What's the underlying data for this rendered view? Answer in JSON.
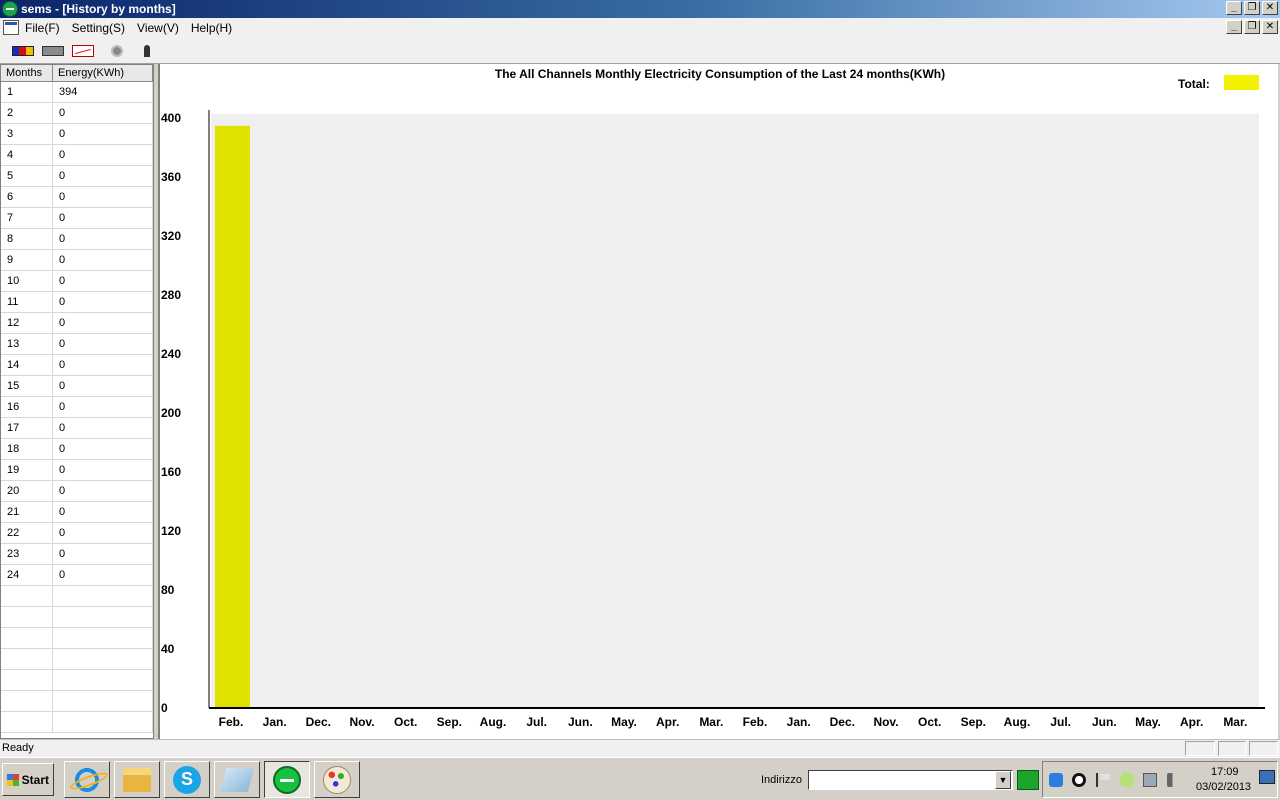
{
  "window": {
    "title": "sems - [History by months]"
  },
  "menu": {
    "items": [
      "File(F)",
      "Setting(S)",
      "View(V)",
      "Help(H)"
    ]
  },
  "table": {
    "headers": [
      "Months",
      "Energy(KWh)"
    ],
    "rows": [
      [
        "1",
        "394"
      ],
      [
        "2",
        "0"
      ],
      [
        "3",
        "0"
      ],
      [
        "4",
        "0"
      ],
      [
        "5",
        "0"
      ],
      [
        "6",
        "0"
      ],
      [
        "7",
        "0"
      ],
      [
        "8",
        "0"
      ],
      [
        "9",
        "0"
      ],
      [
        "10",
        "0"
      ],
      [
        "11",
        "0"
      ],
      [
        "12",
        "0"
      ],
      [
        "13",
        "0"
      ],
      [
        "14",
        "0"
      ],
      [
        "15",
        "0"
      ],
      [
        "16",
        "0"
      ],
      [
        "17",
        "0"
      ],
      [
        "18",
        "0"
      ],
      [
        "19",
        "0"
      ],
      [
        "20",
        "0"
      ],
      [
        "21",
        "0"
      ],
      [
        "22",
        "0"
      ],
      [
        "23",
        "0"
      ],
      [
        "24",
        "0"
      ]
    ],
    "empty_rows": 7
  },
  "chart_data": {
    "type": "bar",
    "title": "The All Channels Monthly Electricity Consumption of the Last 24 months(KWh)",
    "legend": {
      "label": "Total:",
      "color": "#f2f200",
      "placement": "top-right"
    },
    "categories": [
      "Feb.",
      "Jan.",
      "Dec.",
      "Nov.",
      "Oct.",
      "Sep.",
      "Aug.",
      "Jul.",
      "Jun.",
      "May.",
      "Apr.",
      "Mar.",
      "Feb.",
      "Jan.",
      "Dec.",
      "Nov.",
      "Oct.",
      "Sep.",
      "Aug.",
      "Jul.",
      "Jun.",
      "May.",
      "Apr.",
      "Mar."
    ],
    "series": [
      {
        "name": "Total:",
        "color": "#e1e100",
        "values": [
          394,
          0,
          0,
          0,
          0,
          0,
          0,
          0,
          0,
          0,
          0,
          0,
          0,
          0,
          0,
          0,
          0,
          0,
          0,
          0,
          0,
          0,
          0,
          0
        ]
      }
    ],
    "ylim": [
      0,
      400
    ],
    "yticks": [
      0,
      40,
      80,
      120,
      160,
      200,
      240,
      280,
      320,
      360,
      400
    ],
    "plot_background": "#efefef",
    "grid": false
  },
  "status": {
    "text": "Ready"
  },
  "taskbar": {
    "start_label": "Start",
    "address_label": "Indirizzo",
    "address_value": "",
    "clock_time": "17:09",
    "clock_date": "03/02/2013"
  }
}
